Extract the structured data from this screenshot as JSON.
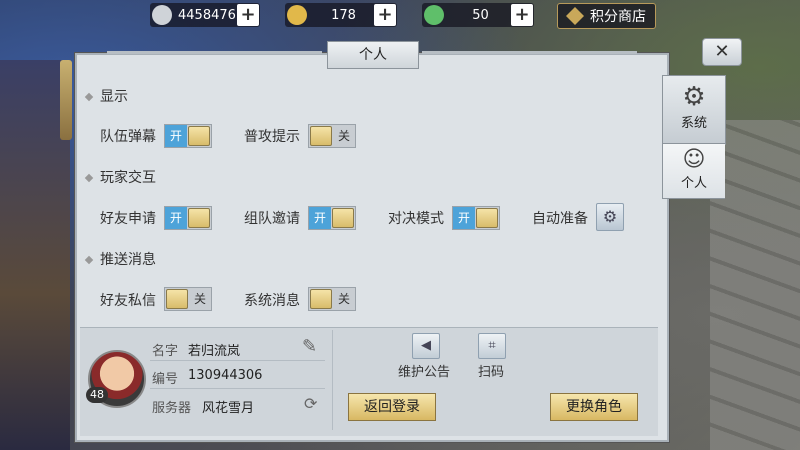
{
  "resources": [
    {
      "icon": "silver-coin-icon",
      "value": "4458476",
      "color": "#cfd3d8"
    },
    {
      "icon": "gold-ingot-icon",
      "value": "178",
      "color": "#e1b84a"
    },
    {
      "icon": "jade-ingot-icon",
      "value": "50",
      "color": "#5fbf6a"
    }
  ],
  "plus_label": "+",
  "shop_label": "积分商店",
  "panel_title": "个人",
  "close_label": "✕",
  "tabs": [
    {
      "label": "系统",
      "icon": "gear-icon"
    },
    {
      "label": "个人",
      "icon": "person-icon"
    }
  ],
  "sections": [
    {
      "title": "显示"
    },
    {
      "title": "玩家交互"
    },
    {
      "title": "推送消息"
    }
  ],
  "settings": {
    "team_popup": {
      "label": "队伍弹幕",
      "state": "开"
    },
    "attack_hint": {
      "label": "普攻提示",
      "state": "关"
    },
    "friend_request": {
      "label": "好友申请",
      "state": "开"
    },
    "team_invite": {
      "label": "组队邀请",
      "state": "开"
    },
    "duel_mode": {
      "label": "对决模式",
      "state": "开"
    },
    "auto_ready": {
      "label": "自动准备"
    },
    "friend_message": {
      "label": "好友私信",
      "state": "关"
    },
    "system_message": {
      "label": "系统消息",
      "state": "关"
    }
  },
  "profile": {
    "name_label": "名字",
    "name": "若归流岚",
    "id_label": "编号",
    "id": "130944306",
    "server_label": "服务器",
    "server": "风花雪月",
    "level": "48"
  },
  "actions": {
    "notice_label": "维护公告",
    "scan_label": "扫码",
    "back_login": "返回登录",
    "switch_role": "更换角色"
  }
}
